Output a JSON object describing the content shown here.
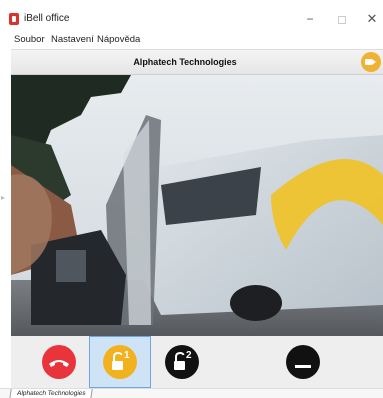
{
  "window": {
    "title": "iBell office",
    "minimize_glyph": "−",
    "close_glyph": "✕"
  },
  "menu": {
    "items": [
      "Soubor",
      "Nastavení",
      "Nápověda"
    ]
  },
  "header": {
    "title": "Alphatech Technologies",
    "record_icon": "video-camera-icon"
  },
  "video": {
    "description_icon": "camera-feed"
  },
  "controls": {
    "hangup_icon": "phone-hangup-icon",
    "lock1_label": "1",
    "lock2_label": "2",
    "mute_icon": "mute-icon",
    "colors": {
      "hangup": "#e8343a",
      "lock1_active": "#f2b21f",
      "lock2": "#111111",
      "mute": "#111111"
    }
  },
  "status": {
    "tab_label": "Alphatech Technologies"
  }
}
